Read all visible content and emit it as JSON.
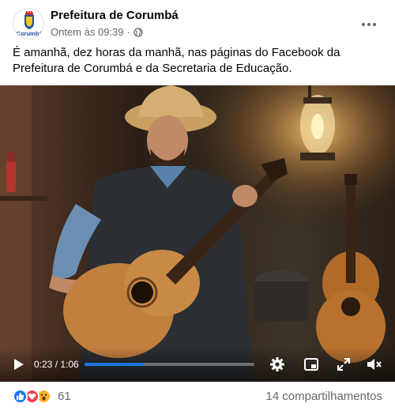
{
  "post": {
    "page_name": "Prefeitura de Corumbá",
    "avatar_text": "Corumbá",
    "timestamp": "Ontem às 09:39",
    "separator": "·",
    "caption": "É amanhã, dez horas da manhã, nas páginas do Facebook da Prefeitura de Corumbá e da Secretaria de Educação."
  },
  "video": {
    "current_time": "0:23",
    "duration": "1:06",
    "time_display": "0:23 / 1:06",
    "progress_fraction": 0.348,
    "accent": "#1b74e4"
  },
  "footer": {
    "reaction_icons": [
      "like-icon",
      "love-icon",
      "wow-icon"
    ],
    "reaction_count": "61",
    "shares": "14 compartilhamentos"
  },
  "icons": {
    "more": "ellipsis-icon",
    "privacy": "globe-icon",
    "play": "play-icon",
    "settings": "gear-icon",
    "miniplayer": "miniplayer-icon",
    "fullscreen": "fullscreen-icon",
    "volume": "mute-icon"
  }
}
